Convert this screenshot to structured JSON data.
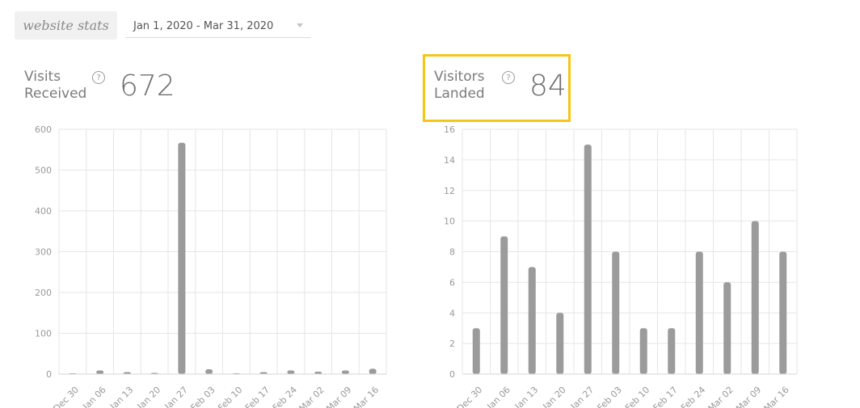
{
  "header": {
    "brand": "website stats",
    "date_range": "Jan 1, 2020 - Mar 31, 2020"
  },
  "metrics": {
    "visits": {
      "label_line1": "Visits",
      "label_line2": "Received",
      "value": "672",
      "help": "?"
    },
    "visitors": {
      "label_line1": "Visitors",
      "label_line2": "Landed",
      "value": "84",
      "help": "?"
    }
  },
  "colors": {
    "bar": "#9b9b9b",
    "grid": "#e6e6e6",
    "highlight": "#f5c518"
  },
  "chart_data": [
    {
      "type": "bar",
      "categories": [
        "Dec 30",
        "Jan 06",
        "Jan 13",
        "Jan 20",
        "Jan 27",
        "Feb 03",
        "Feb 10",
        "Feb 17",
        "Feb 24",
        "Mar 02",
        "Mar 09",
        "Mar 16"
      ],
      "values": [
        2,
        9,
        5,
        3,
        567,
        12,
        2,
        5,
        9,
        6,
        9,
        13
      ],
      "ylim": [
        0,
        600
      ],
      "yticks": [
        0,
        100,
        200,
        300,
        400,
        500,
        600
      ],
      "grid": true
    },
    {
      "type": "bar",
      "categories": [
        "Dec 30",
        "Jan 06",
        "Jan 13",
        "Jan 20",
        "Jan 27",
        "Feb 03",
        "Feb 10",
        "Feb 17",
        "Feb 24",
        "Mar 02",
        "Mar 09",
        "Mar 16"
      ],
      "values": [
        3,
        9,
        7,
        4,
        15,
        8,
        3,
        3,
        8,
        6,
        10,
        8
      ],
      "ylim": [
        0,
        16
      ],
      "yticks": [
        0,
        2,
        4,
        6,
        8,
        10,
        12,
        14,
        16
      ],
      "grid": true
    }
  ]
}
